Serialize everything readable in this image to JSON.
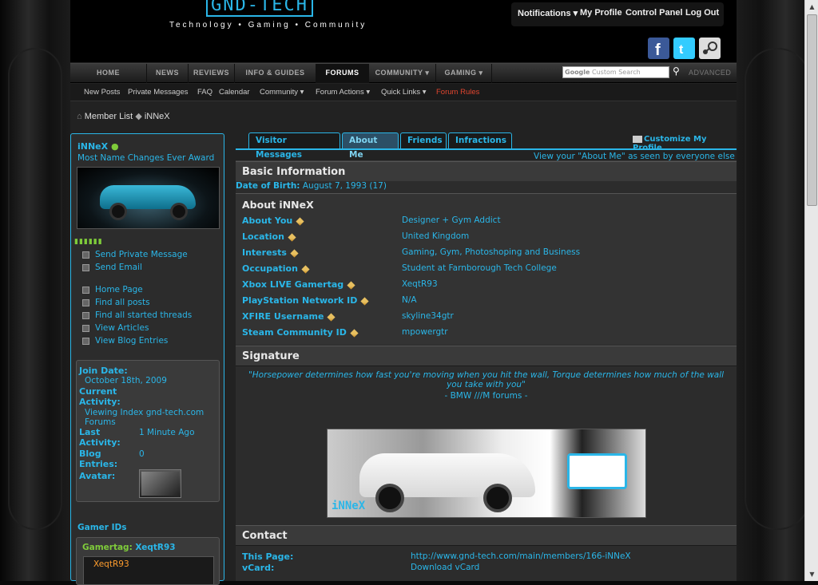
{
  "header": {
    "logo": "GND-TECH",
    "tagline": "Technology • Gaming • Community",
    "userbar": [
      "Notifications ▾",
      "My Profile",
      "Control Panel",
      "Log Out"
    ]
  },
  "nav": {
    "tabs": [
      "HOME",
      "NEWS",
      "REVIEWS",
      "INFO & GUIDES",
      "FORUMS",
      "COMMUNITY ▾",
      "GAMING ▾"
    ],
    "active": "FORUMS",
    "search_placeholder": "Custom Search",
    "search_brand": "Google",
    "advanced": "ADVANCED"
  },
  "subnav": [
    "New Posts",
    "Private Messages",
    "FAQ",
    "Calendar",
    "Community ▾",
    "Forum Actions ▾",
    "Quick Links ▾",
    "Forum Rules"
  ],
  "breadcrumb": {
    "home_icon": "home-icon",
    "root": "Member List",
    "current": "iNNeX"
  },
  "profile": {
    "username": "iNNeX",
    "usertitle": "Most Name Changes Ever Award",
    "rep": "▮▮▮▮▮▮",
    "links": [
      "Send Private Message",
      "Send Email",
      "Home Page",
      "Find all posts",
      "Find all started threads",
      "View Articles",
      "View Blog Entries"
    ],
    "join_label": "Join Date:",
    "join_value": "October 18th, 2009",
    "activity_label": "Current Activity:",
    "activity_value": "Viewing Index gnd-tech.com Forums",
    "last_label": "Last Activity:",
    "last_value": "1 Minute Ago",
    "blog_label": "Blog Entries:",
    "blog_value": "0",
    "avatar_label": "Avatar:",
    "gamer_ids": "Gamer IDs",
    "gamertag_label": "Gamertag:",
    "gamertag_value": "XeqtR93",
    "gamercard_name": "XeqtR93"
  },
  "tabs": [
    "Visitor Messages",
    "About Me",
    "Friends",
    "Infractions"
  ],
  "active_tab": "About Me",
  "customize": "Customize My Profile",
  "view_about": "View your \"About Me\" as seen by everyone else",
  "basic": {
    "title": "Basic Information",
    "dob_label": "Date of Birth:",
    "dob_value": "August 7, 1993 (17)"
  },
  "about": {
    "title": "About iNNeX",
    "fields": [
      {
        "label": "About You",
        "value": "Designer + Gym Addict"
      },
      {
        "label": "Location",
        "value": "United Kingdom"
      },
      {
        "label": "Interests",
        "value": "Gaming, Gym, Photoshoping and Business"
      },
      {
        "label": "Occupation",
        "value": "Student at Farnborough Tech College"
      },
      {
        "label": "Xbox LIVE Gamertag",
        "value": "XeqtR93"
      },
      {
        "label": "PlayStation Network ID",
        "value": "N/A"
      },
      {
        "label": "XFIRE Username",
        "value": "skyline34gtr"
      },
      {
        "label": "Steam Community ID",
        "value": "mpowergtr"
      }
    ]
  },
  "signature": {
    "title": "Signature",
    "quote": "\"Horsepower determines how fast you're moving when you hit the wall, Torque determines how much of the wall you take with you\"",
    "source": "- BMW ///M forums -",
    "image_text": "iNNeX"
  },
  "contact": {
    "title": "Contact",
    "page_label": "This Page:",
    "page_value": "http://www.gnd-tech.com/main/members/166-iNNeX",
    "vcard_label": "vCard:",
    "vcard_value": "Download vCard"
  },
  "colors": {
    "accent": "#2ab6e8",
    "rep": "#7fcc3a",
    "rules": "#e0452f",
    "gamercard": "#ff9d2e"
  }
}
